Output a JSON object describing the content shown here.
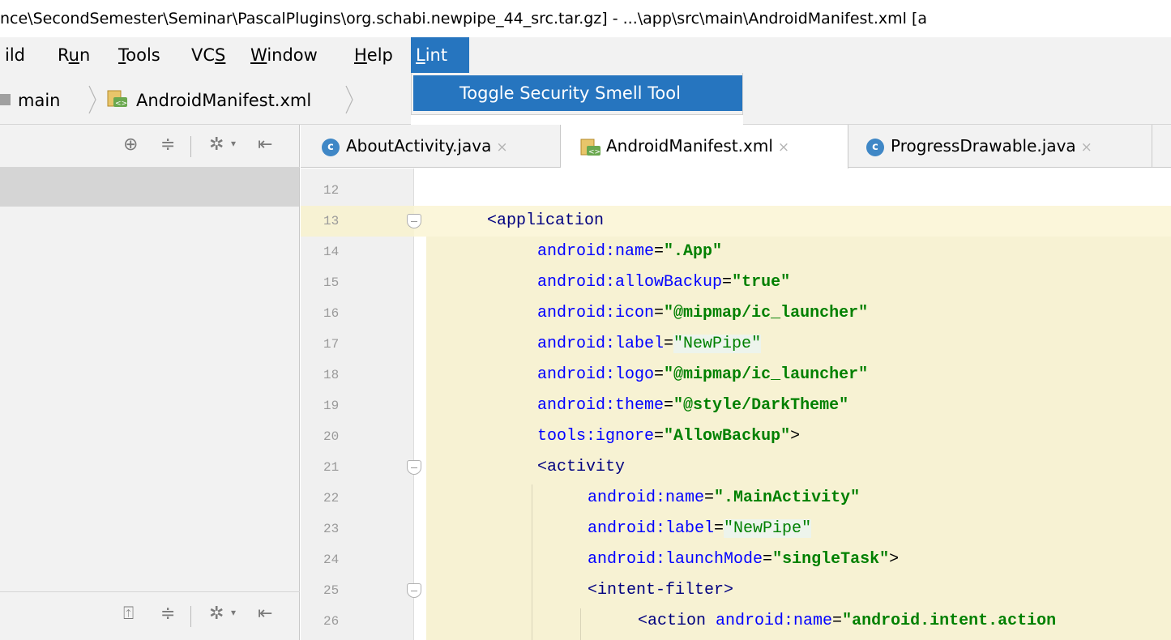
{
  "window": {
    "title": "nce\\SecondSemester\\Seminar\\PascalPlugins\\org.schabi.newpipe_44_src.tar.gz] - ...\\app\\src\\main\\AndroidManifest.xml [a"
  },
  "menubar": {
    "items": [
      "ild",
      "Run",
      "Tools",
      "VCS",
      "Window",
      "Help",
      "Lint"
    ],
    "active": "Lint"
  },
  "lint_menu": {
    "items": [
      "Toggle Security Smell Tool"
    ]
  },
  "breadcrumb": {
    "items": [
      "main",
      "AndroidManifest.xml"
    ]
  },
  "tabs": [
    {
      "label": "AboutActivity.java",
      "icon": "class-icon",
      "close": "×"
    },
    {
      "label": "AndroidManifest.xml",
      "icon": "xml-manifest-icon",
      "close": "×",
      "active": true
    },
    {
      "label": "ProgressDrawable.java",
      "icon": "class-icon",
      "close": "×"
    }
  ],
  "editor": {
    "lines": [
      {
        "n": "12",
        "tokens": []
      },
      {
        "n": "13",
        "fold": true,
        "indent": 0,
        "tokens": [
          [
            "tag",
            "<application"
          ]
        ]
      },
      {
        "n": "14",
        "indent": 1,
        "tokens": [
          [
            "attr",
            "android:name"
          ],
          [
            "punct",
            "="
          ],
          [
            "str",
            "\".App\""
          ]
        ]
      },
      {
        "n": "15",
        "indent": 1,
        "tokens": [
          [
            "attr",
            "android:allowBackup"
          ],
          [
            "punct",
            "="
          ],
          [
            "str",
            "\"true\""
          ]
        ]
      },
      {
        "n": "16",
        "indent": 1,
        "tokens": [
          [
            "attr",
            "android:icon"
          ],
          [
            "punct",
            "="
          ],
          [
            "str",
            "\"@mipmap/ic_launcher\""
          ]
        ]
      },
      {
        "n": "17",
        "indent": 1,
        "tokens": [
          [
            "attr",
            "android:label"
          ],
          [
            "punct",
            "="
          ],
          [
            "strhl",
            "\"NewPipe\""
          ]
        ]
      },
      {
        "n": "18",
        "indent": 1,
        "tokens": [
          [
            "attr",
            "android:logo"
          ],
          [
            "punct",
            "="
          ],
          [
            "str",
            "\"@mipmap/ic_launcher\""
          ]
        ]
      },
      {
        "n": "19",
        "indent": 1,
        "tokens": [
          [
            "attr",
            "android:theme"
          ],
          [
            "punct",
            "="
          ],
          [
            "str",
            "\"@style/DarkTheme\""
          ]
        ]
      },
      {
        "n": "20",
        "indent": 1,
        "tokens": [
          [
            "attr",
            "tools:ignore"
          ],
          [
            "punct",
            "="
          ],
          [
            "str",
            "\"AllowBackup\""
          ],
          [
            "punct",
            ">"
          ]
        ]
      },
      {
        "n": "21",
        "fold": true,
        "indent": 1,
        "tokens": [
          [
            "tag",
            "<activity"
          ]
        ]
      },
      {
        "n": "22",
        "indent": 2,
        "tokens": [
          [
            "attr",
            "android:name"
          ],
          [
            "punct",
            "="
          ],
          [
            "str",
            "\".MainActivity\""
          ]
        ]
      },
      {
        "n": "23",
        "indent": 2,
        "tokens": [
          [
            "attr",
            "android:label"
          ],
          [
            "punct",
            "="
          ],
          [
            "strhl",
            "\"NewPipe\""
          ]
        ]
      },
      {
        "n": "24",
        "indent": 2,
        "tokens": [
          [
            "attr",
            "android:launchMode"
          ],
          [
            "punct",
            "="
          ],
          [
            "str",
            "\"singleTask\""
          ],
          [
            "punct",
            ">"
          ]
        ]
      },
      {
        "n": "25",
        "fold": true,
        "indent": 2,
        "tokens": [
          [
            "tag",
            "<intent-filter>"
          ]
        ]
      },
      {
        "n": "26",
        "indent": 3,
        "tokens": [
          [
            "tag",
            "<action "
          ],
          [
            "attr",
            "android:name"
          ],
          [
            "punct",
            "="
          ],
          [
            "str",
            "\"android.intent.action"
          ]
        ]
      }
    ]
  },
  "colors": {
    "accent": "#2675bf",
    "panel": "#f2f2f2",
    "code_highlight": "#f7f2d3"
  }
}
